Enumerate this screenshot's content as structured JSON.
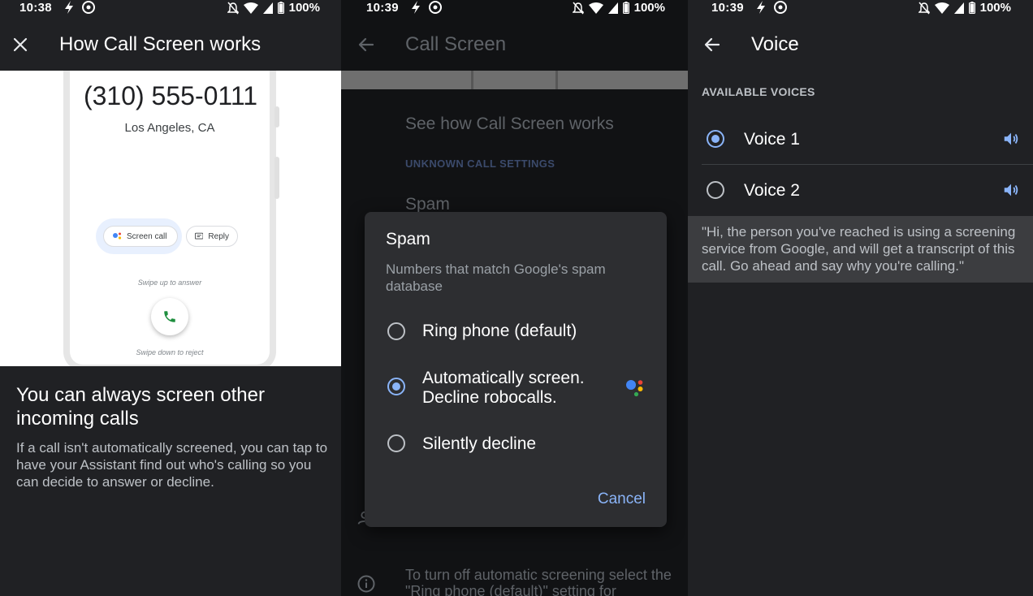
{
  "colors": {
    "accent": "#8ab4f8",
    "background": "#202124",
    "dialog": "#2d2e31"
  },
  "panel1": {
    "status": {
      "time": "10:38",
      "battery": "100%"
    },
    "close_icon": "close-icon",
    "title": "How Call Screen works",
    "illustration": {
      "phone_number": "(310) 555-0111",
      "location": "Los Angeles, CA",
      "screen_call_label": "Screen call",
      "reply_label": "Reply",
      "swipe_up": "Swipe up to answer",
      "swipe_down": "Swipe down to reject"
    },
    "heading": "You can always screen other incoming calls",
    "body": "If a call isn't automatically screened, you can tap to have your Assistant find out who's calling so you can decide to answer or decline."
  },
  "panel2": {
    "status": {
      "time": "10:39",
      "battery": "100%"
    },
    "title": "Call Screen",
    "see_how": "See how Call Screen works",
    "section": "UNKNOWN CALL SETTINGS",
    "spam_row": "Spam",
    "footer_text": "To turn off automatic screening select the \"Ring phone (default)\" setting for",
    "dialog": {
      "title": "Spam",
      "description": "Numbers that match Google's spam database",
      "options": [
        {
          "label": "Ring phone (default)",
          "selected": false
        },
        {
          "label": "Automatically screen. Decline robocalls.",
          "selected": true
        },
        {
          "label": "Silently decline",
          "selected": false
        }
      ],
      "cancel": "Cancel"
    }
  },
  "panel3": {
    "status": {
      "time": "10:39",
      "battery": "100%"
    },
    "title": "Voice",
    "section": "AVAILABLE VOICES",
    "voices": [
      {
        "label": "Voice 1",
        "selected": true
      },
      {
        "label": "Voice 2",
        "selected": false
      }
    ],
    "greeting": "\"Hi, the person you've reached is using a screening service from Google, and will get a transcript of this call. Go ahead and say why you're calling.\""
  }
}
